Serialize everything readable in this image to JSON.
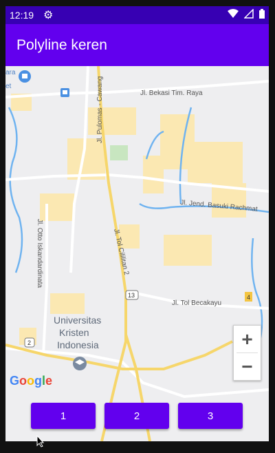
{
  "status_bar": {
    "time": "12:19"
  },
  "app_bar": {
    "title": "Polyline keren"
  },
  "map": {
    "labels": {
      "bekasi": "Jl. Bekasi Tim. Raya",
      "pulomas": "Jl. Pulomas - Cawang",
      "basuki": "Jl. Jend. Basuki Rachmat",
      "otto": "Jl. Otto Iskandardinata",
      "cililitan": "Jl. Tol Cililitan 2",
      "becakayu": "Jl. Tol Becakayu",
      "university": [
        "Universitas",
        "Kristen",
        "Indonesia"
      ],
      "route_13": "13",
      "route_2": "2",
      "route_4": "4",
      "top_left_1": "ara",
      "top_left_2": "et"
    },
    "zoom": {
      "in": "+",
      "out": "−"
    },
    "google_logo": [
      "G",
      "o",
      "o",
      "g",
      "l",
      "e"
    ],
    "google_colors": [
      "#4285F4",
      "#EA4335",
      "#FBBC05",
      "#4285F4",
      "#34A853",
      "#EA4335"
    ]
  },
  "buttons": [
    "1",
    "2",
    "3"
  ],
  "colors": {
    "status": "#3700b3",
    "primary": "#6200ee"
  }
}
